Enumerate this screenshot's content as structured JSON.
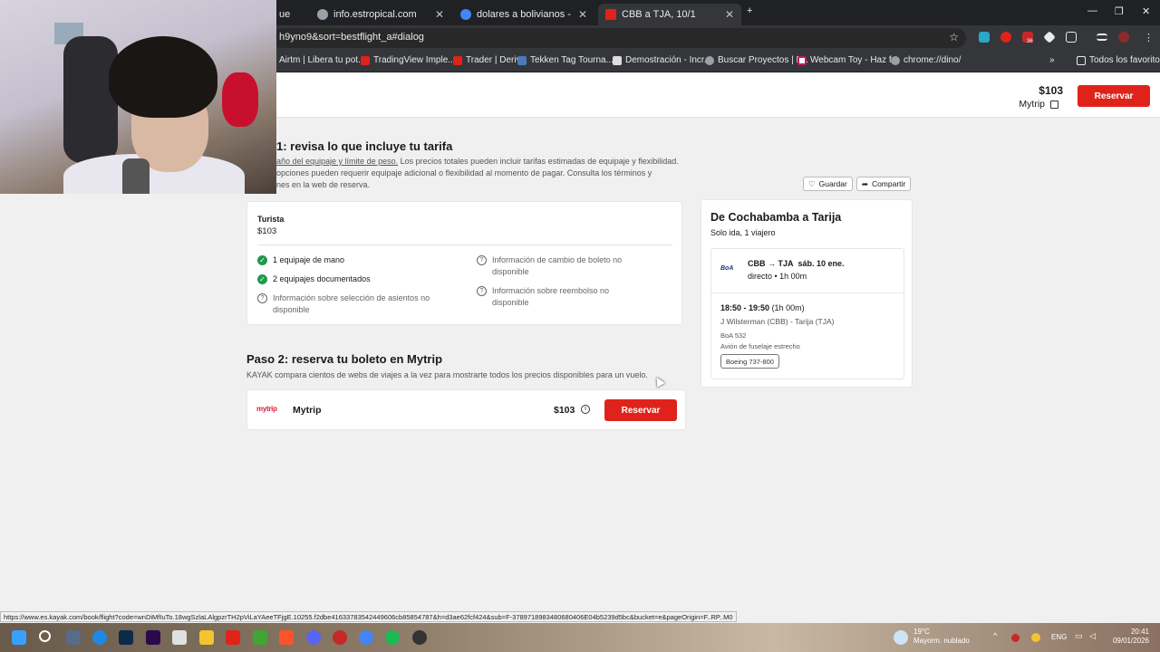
{
  "browser": {
    "tabs": [
      {
        "label": "ue",
        "active": false
      },
      {
        "label": "info.estropical.com",
        "active": false
      },
      {
        "label": "dolares a bolivianos - Buscar co",
        "active": false
      },
      {
        "label": "CBB a TJA, 10/1",
        "active": true
      }
    ],
    "url": "h9yno9&sort=bestflight_a#dialog",
    "bookmarks": [
      "Airtm | Libera tu pot...",
      "TradingView Imple...",
      "Trader | Deriv",
      "Tekken Tag Tourna...",
      "Demostración - Incr...",
      "Buscar Proyectos | F...",
      "Webcam Toy - Haz f...",
      "chrome://dino/"
    ],
    "bookmarks_all": "Todos los favoritos",
    "extension_badge": "36"
  },
  "header": {
    "price": "$103",
    "provider": "Mytrip",
    "book_label": "Reservar"
  },
  "step1": {
    "title": "1: revisa lo que incluye tu tarifa",
    "link_text": "año del equipaje y límite de peso.",
    "desc1": " Los precios totales pueden incluir tarifas estimadas de equipaje y flexibilidad.",
    "desc2": "opciones pueden requerir equipaje adicional o flexibilidad al momento de pagar. Consulta los términos y",
    "desc3": "nes en la web de reserva."
  },
  "fare": {
    "class": "Turista",
    "price": "$103",
    "features_left": [
      {
        "text": "1 equipaje de mano",
        "included": true
      },
      {
        "text": "2 equipajes documentados",
        "included": true
      },
      {
        "text": "Información sobre selección de asientos no disponible",
        "included": false
      }
    ],
    "features_right": [
      {
        "text": "Información de cambio de boleto no disponible",
        "included": false
      },
      {
        "text": "Información sobre reembolso no disponible",
        "included": false
      }
    ]
  },
  "step2": {
    "title": "Paso 2: reserva tu boleto en Mytrip",
    "desc": "KAYAK compara cientos de webs de viajes a la vez para mostrarte todos los precios disponibles para un vuelo."
  },
  "provider_row": {
    "logo": "mytrip",
    "name": "Mytrip",
    "price": "$103",
    "book_label": "Reservar"
  },
  "actions": {
    "save": "Guardar",
    "share": "Compartir"
  },
  "trip": {
    "title": "De Cochabamba a Tarija",
    "subtitle": "Solo ida, 1 viajero",
    "airline_logo": "BoA",
    "route": "CBB → TJA",
    "date": "sáb. 10 ene.",
    "duration": "directo • 1h 00m",
    "times": "18:50 - 19:50",
    "times_dur": "(1h 00m)",
    "airports": "J Wilsterman (CBB) - Tarija (TJA)",
    "flight": "BoA 532",
    "body": "Avión de fuselaje estrecho",
    "aircraft": "Boeing 737-800"
  },
  "status_url": "https://www.es.kayak.com/book/flight?code=wnDiMfIuTo.18wgSzlaLAlgpzrTH2pViLaYAeeTFjgE.10255.f2dbe41633783542449606cb85854787&h=d3ae62fcf424&sub=F-3789718983480680406E04b5239d5bc&bucket=e&pageOrigin=F..RP..M0",
  "taskbar": {
    "weather_temp": "19°C",
    "weather_desc": "Mayorm. nublado",
    "lang": "ENG",
    "time": "20:41",
    "date": "09/01/2026"
  },
  "colors": {
    "brand_red": "#e0231a",
    "check_green": "#1e9a4a",
    "chrome_dark": "#202124"
  }
}
